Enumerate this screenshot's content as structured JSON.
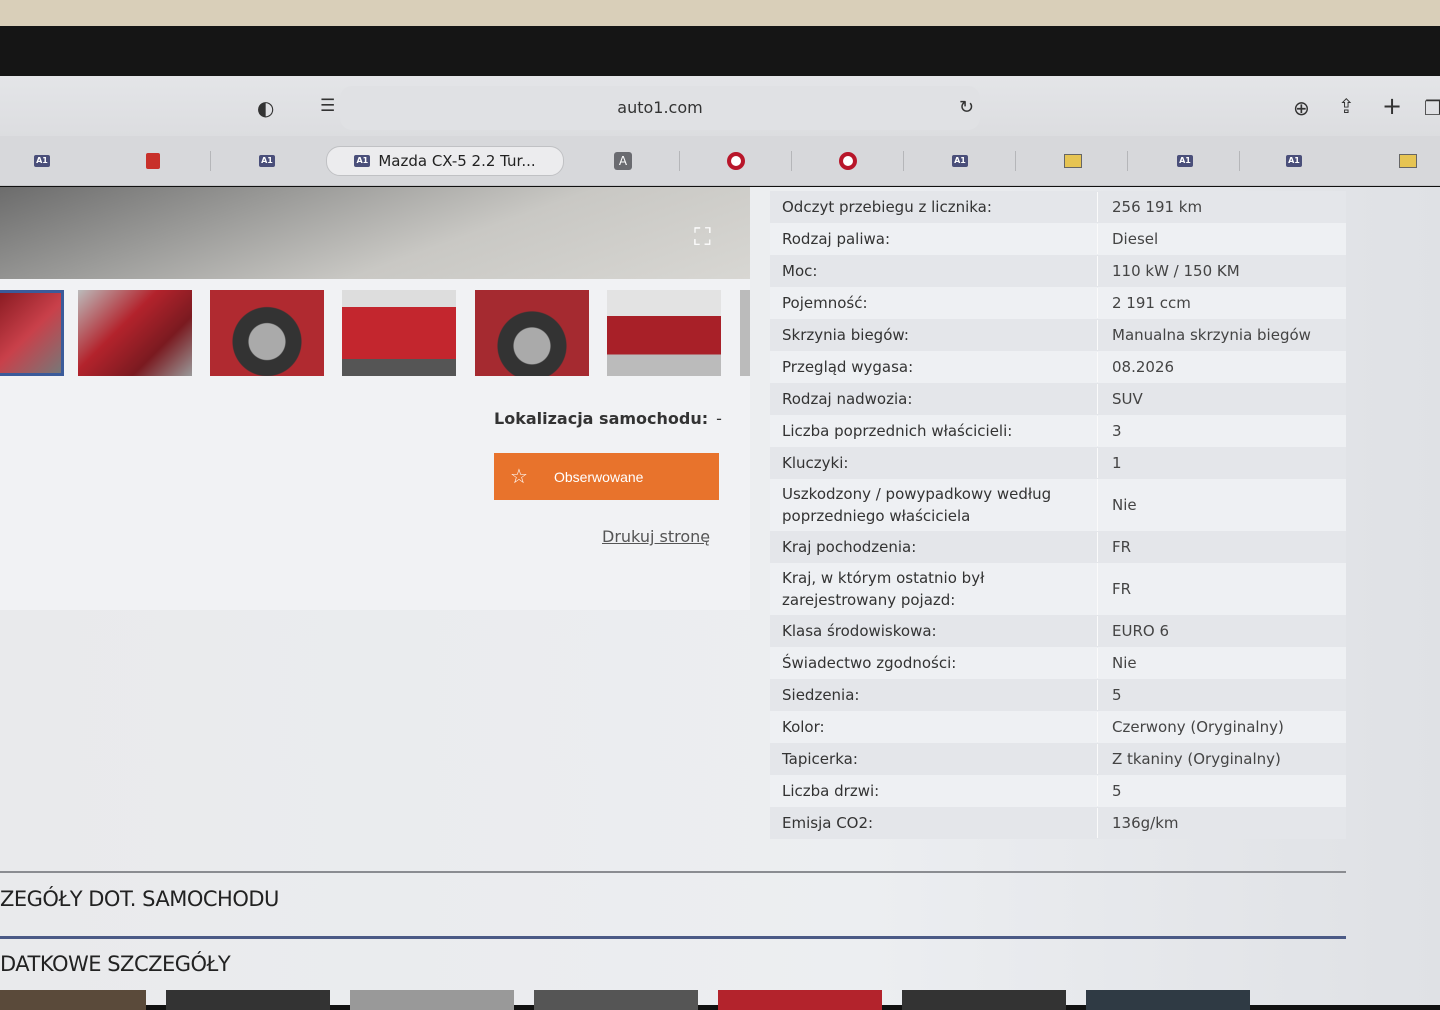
{
  "browser": {
    "url": "auto1.com",
    "active_tab": "Mazda CX-5 2.2 Tur...",
    "tab_favicon_label": "A1",
    "tab_letter": "A"
  },
  "gallery": {
    "location_label": "Lokalizacja samochodu:",
    "location_value": "-",
    "watch_button": "Obserwowane",
    "print_link": "Drukuj stronę"
  },
  "specs": [
    {
      "k": "Odczyt przebiegu z licznika:",
      "v": "256 191 km"
    },
    {
      "k": "Rodzaj paliwa:",
      "v": "Diesel"
    },
    {
      "k": "Moc:",
      "v": "110 kW / 150 KM"
    },
    {
      "k": "Pojemność:",
      "v": "2 191 ccm"
    },
    {
      "k": "Skrzynia biegów:",
      "v": "Manualna skrzynia biegów"
    },
    {
      "k": "Przegląd wygasa:",
      "v": "08.2026"
    },
    {
      "k": "Rodzaj nadwozia:",
      "v": "SUV"
    },
    {
      "k": "Liczba poprzednich właścicieli:",
      "v": "3"
    },
    {
      "k": "Kluczyki:",
      "v": "1"
    },
    {
      "k": "Uszkodzony / powypadkowy według poprzedniego właściciela",
      "v": "Nie"
    },
    {
      "k": "Kraj pochodzenia:",
      "v": "FR"
    },
    {
      "k": "Kraj, w którym ostatnio był zarejestrowany pojazd:",
      "v": "FR"
    },
    {
      "k": "Klasa środowiskowa:",
      "v": "EURO 6"
    },
    {
      "k": "Świadectwo zgodności:",
      "v": "Nie"
    },
    {
      "k": "Siedzenia:",
      "v": "5"
    },
    {
      "k": "Kolor:",
      "v": "Czerwony (Oryginalny)"
    },
    {
      "k": "Tapicerka:",
      "v": "Z tkaniny (Oryginalny)"
    },
    {
      "k": "Liczba drzwi:",
      "v": "5"
    },
    {
      "k": "Emisja CO2:",
      "v": "136g/km"
    }
  ],
  "sections": {
    "details": "ZEGÓŁY DOT. SAMOCHODU",
    "additional": "DATKOWE SZCZEGÓŁY"
  }
}
